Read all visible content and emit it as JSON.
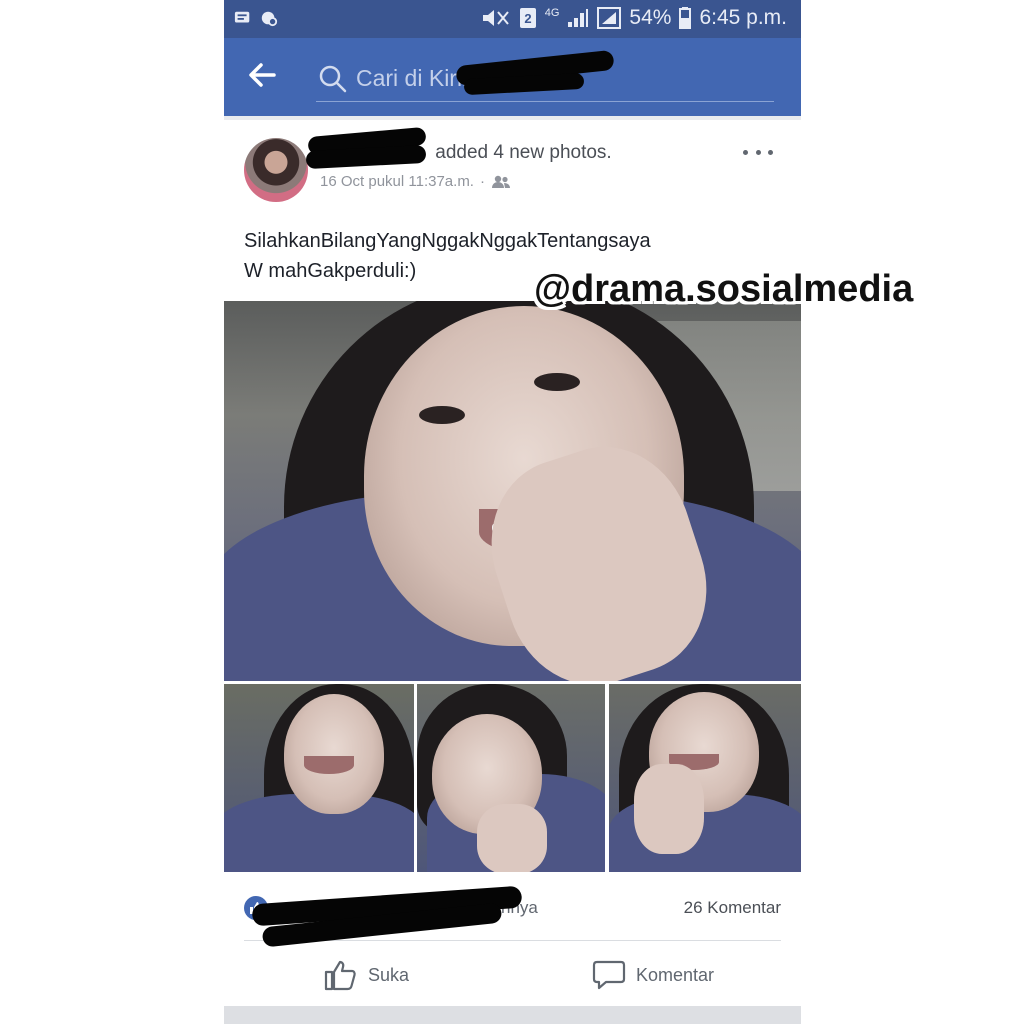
{
  "status_bar": {
    "battery": "54%",
    "time": "6:45 p.m.",
    "network": "4G",
    "sim": "2"
  },
  "search": {
    "placeholder": "Cari di Kirim"
  },
  "post": {
    "author_action": "added 4 new photos.",
    "timestamp": "16 Oct pukul 11:37a.m.",
    "separator": "·",
    "text_line1": "SilahkanBilangYangNggakNggakTentangsaya",
    "text_line2": "W mahGakperduli:)",
    "photo_count": 4
  },
  "watermark": "@drama.sosialmedia",
  "reactions": {
    "others_text": "lainnya",
    "comments": "26 Komentar"
  },
  "actions": {
    "like_label": "Suka",
    "comment_label": "Komentar"
  },
  "colors": {
    "header_blue": "#4267b2",
    "status_blue": "#3a5590",
    "text_dark": "#1d2129",
    "text_meta": "#90949c"
  }
}
